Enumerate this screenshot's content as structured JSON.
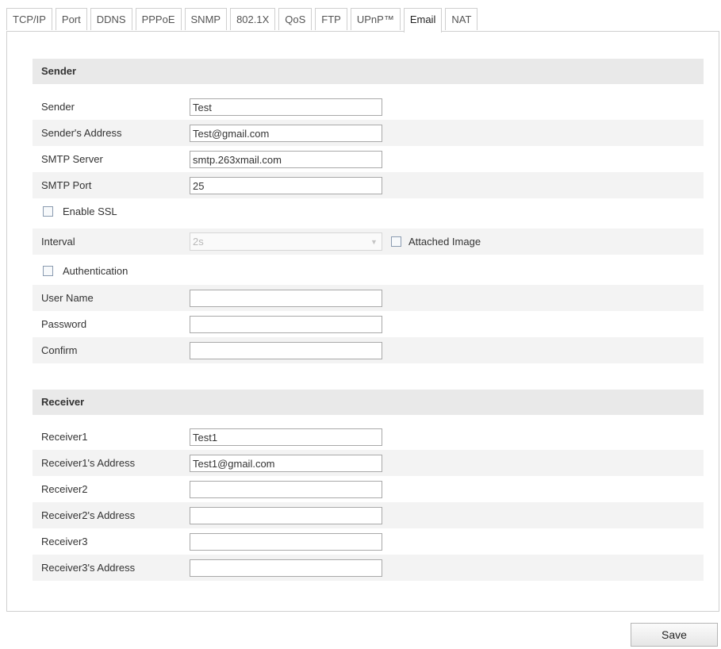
{
  "tabs": [
    "TCP/IP",
    "Port",
    "DDNS",
    "PPPoE",
    "SNMP",
    "802.1X",
    "QoS",
    "FTP",
    "UPnP™",
    "Email",
    "NAT"
  ],
  "active_tab": "Email",
  "sender_section": {
    "title": "Sender",
    "sender": {
      "label": "Sender",
      "value": "Test"
    },
    "address": {
      "label": "Sender's Address",
      "value": "Test@gmail.com"
    },
    "smtp_server": {
      "label": "SMTP Server",
      "value": "smtp.263xmail.com"
    },
    "smtp_port": {
      "label": "SMTP Port",
      "value": "25"
    },
    "enable_ssl": {
      "label": "Enable SSL",
      "checked": false
    },
    "interval": {
      "label": "Interval",
      "value": "2s"
    },
    "attached_image": {
      "label": "Attached Image",
      "checked": false
    },
    "authentication": {
      "label": "Authentication",
      "checked": false
    },
    "user_name": {
      "label": "User Name",
      "value": ""
    },
    "password": {
      "label": "Password",
      "value": ""
    },
    "confirm": {
      "label": "Confirm",
      "value": ""
    }
  },
  "receiver_section": {
    "title": "Receiver",
    "receiver1": {
      "label": "Receiver1",
      "value": "Test1"
    },
    "receiver1_address": {
      "label": "Receiver1's Address",
      "value": "Test1@gmail.com"
    },
    "receiver2": {
      "label": "Receiver2",
      "value": ""
    },
    "receiver2_address": {
      "label": "Receiver2's Address",
      "value": ""
    },
    "receiver3": {
      "label": "Receiver3",
      "value": ""
    },
    "receiver3_address": {
      "label": "Receiver3's Address",
      "value": ""
    }
  },
  "save_label": "Save"
}
